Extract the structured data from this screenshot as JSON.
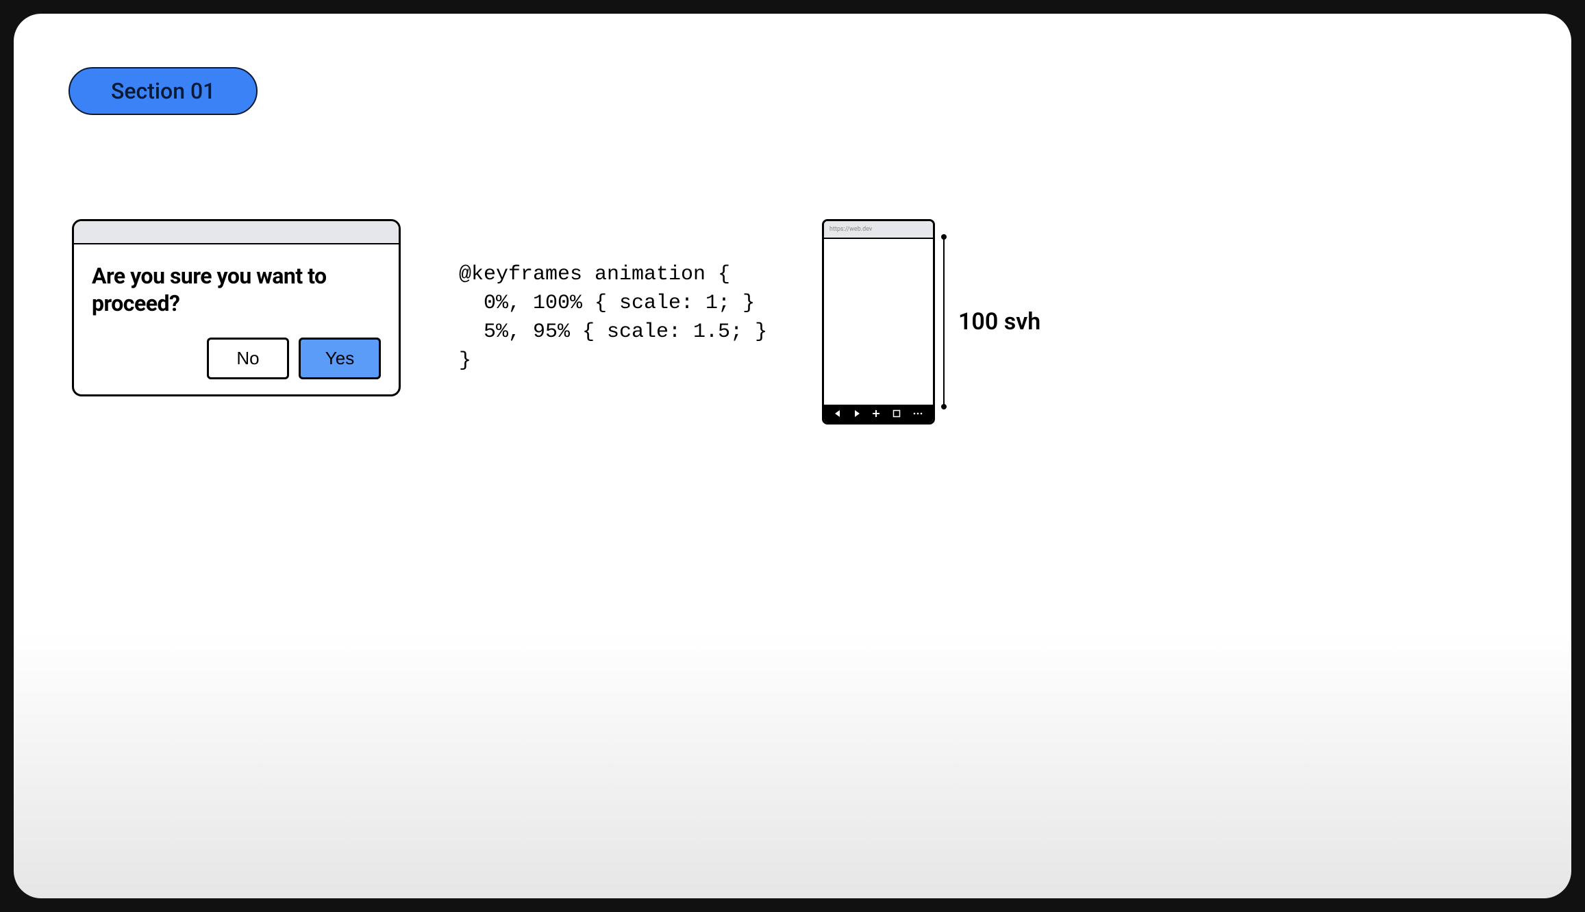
{
  "section_pill": {
    "label": "Section 01"
  },
  "dialog": {
    "message": "Are you sure you want to proceed?",
    "no_label": "No",
    "yes_label": "Yes"
  },
  "code": {
    "line1": "@keyframes animation {",
    "line2": "  0%, 100% { scale: 1; }",
    "line3": "  5%, 95% { scale: 1.5; }",
    "line4": "}"
  },
  "phone": {
    "url": "https://web.dev"
  },
  "dimension": {
    "label": "100 svh"
  }
}
